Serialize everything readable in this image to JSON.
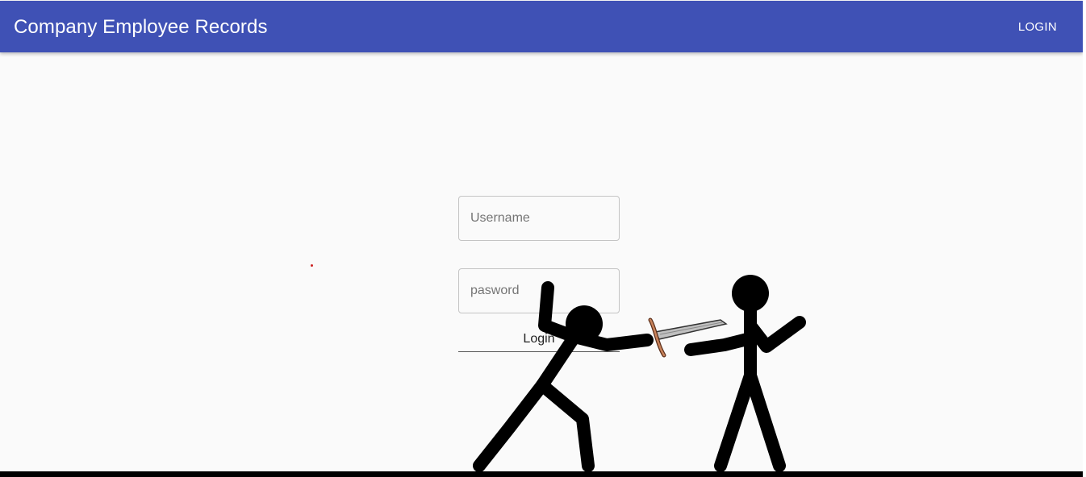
{
  "appbar": {
    "title": "Company Employee Records",
    "login_label": "LOGIN",
    "color": "#3f51b5"
  },
  "login_form": {
    "username_placeholder": "Username",
    "password_placeholder": "pasword",
    "submit_label": "Login"
  },
  "overlay": {
    "figures": [
      "stick-figure-attacker-icon",
      "stick-figure-defender-icon",
      "sword-icon"
    ],
    "figure_color": "#000000",
    "sword_blade_color": "#c0c0c0",
    "sword_hilt_color": "#c8825a"
  },
  "colors": {
    "page_background": "#fafafa",
    "ground": "#000000"
  }
}
